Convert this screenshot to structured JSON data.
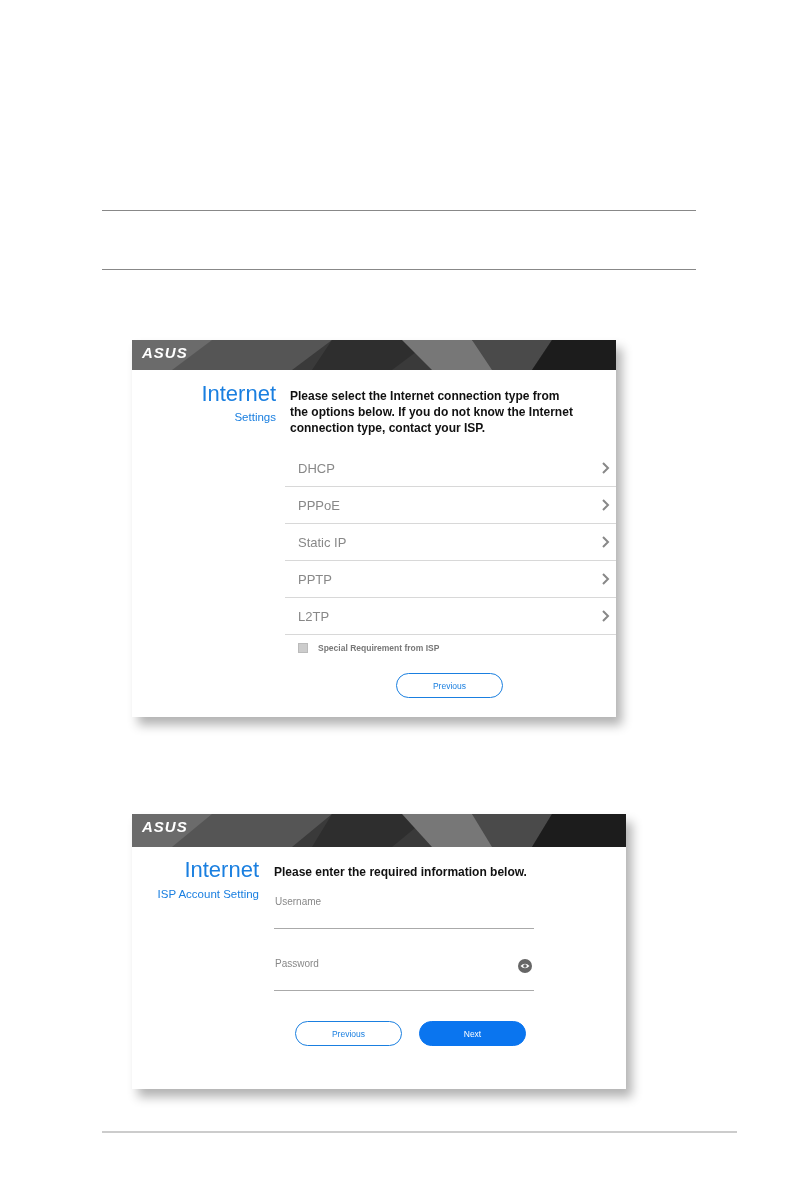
{
  "screens": [
    {
      "kind": "connection_type",
      "logo": "ASUS",
      "title": "Internet",
      "subtitle": "Settings",
      "prompt": "Please select the Internet connection type from the options below. If you do not know the Internet connection type, contact your ISP.",
      "options": [
        {
          "label": "DHCP"
        },
        {
          "label": "PPPoE"
        },
        {
          "label": "Static IP"
        },
        {
          "label": "PPTP"
        },
        {
          "label": "L2TP"
        }
      ],
      "checkbox": {
        "label": "Special Requirement from ISP",
        "checked": false
      },
      "buttons": [
        {
          "label": "Previous",
          "kind": "outline"
        }
      ]
    },
    {
      "kind": "account",
      "logo": "ASUS",
      "title": "Internet",
      "subtitle": "ISP Account Setting",
      "prompt": "Please enter the required information below.",
      "fields": [
        {
          "placeholder": "Username",
          "kind": "text"
        },
        {
          "placeholder": "Password",
          "kind": "password"
        }
      ],
      "buttons": [
        {
          "label": "Previous",
          "kind": "outline"
        },
        {
          "label": "Next",
          "kind": "primary"
        }
      ]
    }
  ]
}
